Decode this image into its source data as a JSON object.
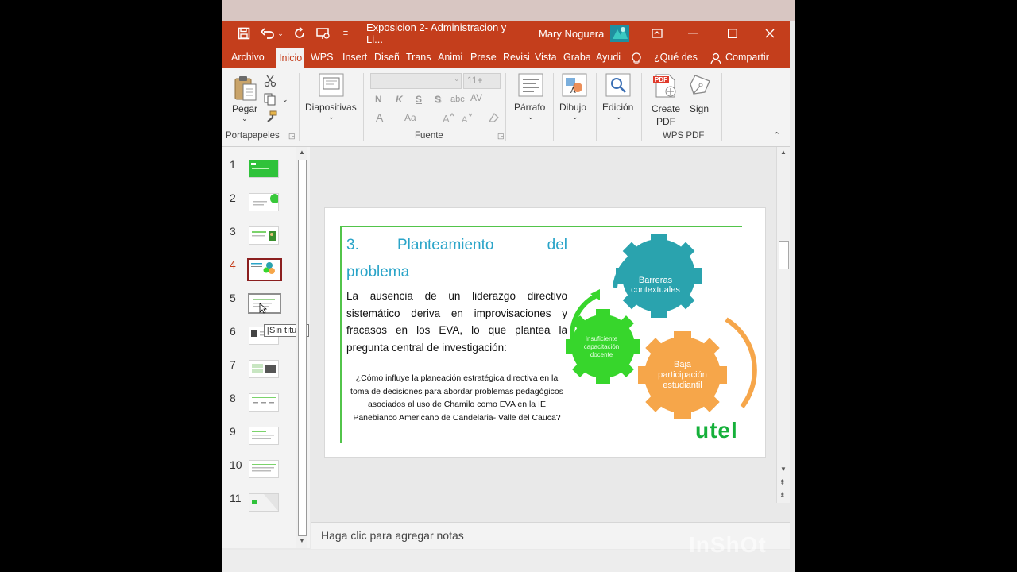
{
  "titlebar": {
    "doc_title": "Exposicion 2- Administracion y Li...",
    "user_name": "Mary Noguera"
  },
  "menu": [
    "Archivo",
    "Inicio",
    "WPS I",
    "Insert",
    "Diseñ",
    "Transi",
    "Animi",
    "Preser",
    "Revisi",
    "Vista",
    "Graba",
    "Ayudi",
    "¿Qué des",
    "Compartir"
  ],
  "ribbon": {
    "pegar": "Pegar",
    "portapapeles": "Portapapeles",
    "diapositivas": "Diapositivas",
    "font_size": "11+",
    "fuente": "Fuente",
    "bold": "N",
    "italic": "K",
    "underline": "S",
    "shadow": "S",
    "strike": "abc",
    "spacing": "AV",
    "font_color": "A",
    "change_case": "Aa",
    "parrafo": "Párrafo",
    "dibujo": "Dibujo",
    "edicion": "Edición",
    "create_pdf_1": "Create",
    "create_pdf_2": "PDF",
    "sign": "Sign",
    "wps_pdf": "WPS PDF",
    "pdf_badge": "PDF"
  },
  "thumbs": [
    "1",
    "2",
    "3",
    "4",
    "5",
    "6",
    "7",
    "8",
    "9",
    "10",
    "11"
  ],
  "tooltip": "[Sin título]",
  "slide": {
    "heading_num": "3.",
    "heading_w1": "Planteamiento",
    "heading_w2": "del",
    "heading_w3": "problema",
    "body": "La ausencia de un liderazgo directivo sistemático deriva en improvisaciones y fracasos en los EVA, lo que plantea la pregunta central de investigación:",
    "question": "¿Cómo influye la planeación estratégica directiva en la toma de decisiones para abordar problemas pedagógicos asociados al uso de Chamilo como EVA en la IE Panebianco Americano de Candelaria- Valle del Cauca?",
    "gear1_l1": "Barreras",
    "gear1_l2": "contextuales",
    "gear2_l1": "Insuficiente",
    "gear2_l2": "capacitación",
    "gear2_l3": "docente",
    "gear3_l1": "Baja",
    "gear3_l2": "participación",
    "gear3_l3": "estudiantil",
    "logo": "utel"
  },
  "notes_placeholder": "Haga clic para agregar notas",
  "watermark": "InShOt",
  "colors": {
    "brand": "#c43e1c",
    "teal": "#2aa3ae",
    "green": "#37d62c",
    "orange": "#f6a64a",
    "title_blue": "#2aa4c8",
    "utel_green": "#15b03a"
  }
}
